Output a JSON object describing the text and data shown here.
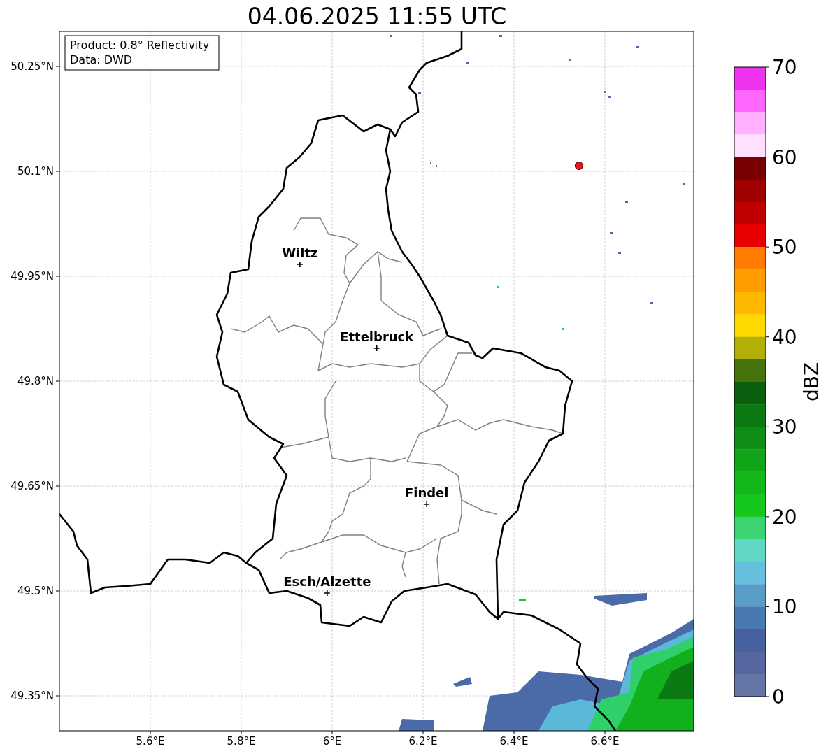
{
  "title": "04.06.2025 11:55 UTC",
  "info_box": [
    "Product: 0.8° Reflectivity",
    "Data: DWD"
  ],
  "y_ticks": [
    "50.25°N",
    "50.1°N",
    "49.95°N",
    "49.8°N",
    "49.65°N",
    "49.5°N",
    "49.35°N"
  ],
  "cities": [
    {
      "name": "Wiltz"
    },
    {
      "name": "Ettelbruck"
    },
    {
      "name": "Findel"
    },
    {
      "name": "Esch/Alzette"
    }
  ],
  "x_ticks": [
    "5.6°E",
    "5.8°E",
    "6°E",
    "6.2°E",
    "6.4°E",
    "6.6°E"
  ],
  "colorbar": {
    "ticks": [
      "70",
      "60",
      "50",
      "40",
      "30",
      "20",
      "10",
      "0"
    ],
    "bands": [
      {
        "color": "#ee33ee"
      },
      {
        "color": "#ff66ff"
      },
      {
        "color": "#ffb0ff"
      },
      {
        "color": "#ffe0ff"
      },
      {
        "color": "#780000"
      },
      {
        "color": "#a00000"
      },
      {
        "color": "#c00000"
      },
      {
        "color": "#e80000"
      },
      {
        "color": "#ff7c00"
      },
      {
        "color": "#ff9c00"
      },
      {
        "color": "#ffb800"
      },
      {
        "color": "#ffd800"
      },
      {
        "color": "#b0b008"
      },
      {
        "color": "#46740c"
      },
      {
        "color": "#0a600e"
      },
      {
        "color": "#0c7812"
      },
      {
        "color": "#0e8e16"
      },
      {
        "color": "#10a418"
      },
      {
        "color": "#12b81a"
      },
      {
        "color": "#14c81e"
      },
      {
        "color": "#3cd470"
      },
      {
        "color": "#60d8c4"
      },
      {
        "color": "#64c0dc"
      },
      {
        "color": "#5a9cc8"
      },
      {
        "color": "#4a78b0"
      },
      {
        "color": "#4860a0"
      },
      {
        "color": "#5566a0"
      },
      {
        "color": "#6475a6"
      }
    ],
    "label": "dBZ"
  }
}
